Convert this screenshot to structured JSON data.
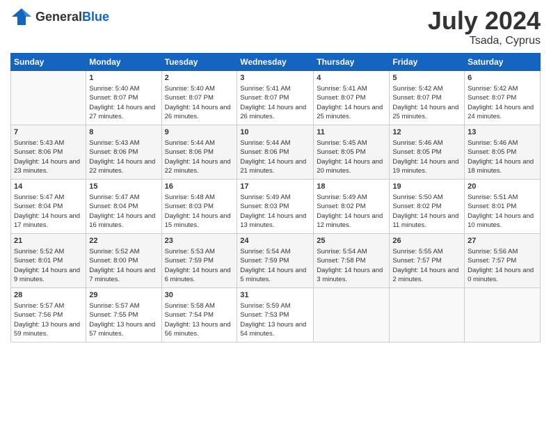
{
  "logo": {
    "general": "General",
    "blue": "Blue"
  },
  "title": "July 2024",
  "subtitle": "Tsada, Cyprus",
  "headers": [
    "Sunday",
    "Monday",
    "Tuesday",
    "Wednesday",
    "Thursday",
    "Friday",
    "Saturday"
  ],
  "weeks": [
    [
      {
        "day": "",
        "sunrise": "",
        "sunset": "",
        "daylight": ""
      },
      {
        "day": "1",
        "sunrise": "Sunrise: 5:40 AM",
        "sunset": "Sunset: 8:07 PM",
        "daylight": "Daylight: 14 hours and 27 minutes."
      },
      {
        "day": "2",
        "sunrise": "Sunrise: 5:40 AM",
        "sunset": "Sunset: 8:07 PM",
        "daylight": "Daylight: 14 hours and 26 minutes."
      },
      {
        "day": "3",
        "sunrise": "Sunrise: 5:41 AM",
        "sunset": "Sunset: 8:07 PM",
        "daylight": "Daylight: 14 hours and 26 minutes."
      },
      {
        "day": "4",
        "sunrise": "Sunrise: 5:41 AM",
        "sunset": "Sunset: 8:07 PM",
        "daylight": "Daylight: 14 hours and 25 minutes."
      },
      {
        "day": "5",
        "sunrise": "Sunrise: 5:42 AM",
        "sunset": "Sunset: 8:07 PM",
        "daylight": "Daylight: 14 hours and 25 minutes."
      },
      {
        "day": "6",
        "sunrise": "Sunrise: 5:42 AM",
        "sunset": "Sunset: 8:07 PM",
        "daylight": "Daylight: 14 hours and 24 minutes."
      }
    ],
    [
      {
        "day": "7",
        "sunrise": "Sunrise: 5:43 AM",
        "sunset": "Sunset: 8:06 PM",
        "daylight": "Daylight: 14 hours and 23 minutes."
      },
      {
        "day": "8",
        "sunrise": "Sunrise: 5:43 AM",
        "sunset": "Sunset: 8:06 PM",
        "daylight": "Daylight: 14 hours and 22 minutes."
      },
      {
        "day": "9",
        "sunrise": "Sunrise: 5:44 AM",
        "sunset": "Sunset: 8:06 PM",
        "daylight": "Daylight: 14 hours and 22 minutes."
      },
      {
        "day": "10",
        "sunrise": "Sunrise: 5:44 AM",
        "sunset": "Sunset: 8:06 PM",
        "daylight": "Daylight: 14 hours and 21 minutes."
      },
      {
        "day": "11",
        "sunrise": "Sunrise: 5:45 AM",
        "sunset": "Sunset: 8:05 PM",
        "daylight": "Daylight: 14 hours and 20 minutes."
      },
      {
        "day": "12",
        "sunrise": "Sunrise: 5:46 AM",
        "sunset": "Sunset: 8:05 PM",
        "daylight": "Daylight: 14 hours and 19 minutes."
      },
      {
        "day": "13",
        "sunrise": "Sunrise: 5:46 AM",
        "sunset": "Sunset: 8:05 PM",
        "daylight": "Daylight: 14 hours and 18 minutes."
      }
    ],
    [
      {
        "day": "14",
        "sunrise": "Sunrise: 5:47 AM",
        "sunset": "Sunset: 8:04 PM",
        "daylight": "Daylight: 14 hours and 17 minutes."
      },
      {
        "day": "15",
        "sunrise": "Sunrise: 5:47 AM",
        "sunset": "Sunset: 8:04 PM",
        "daylight": "Daylight: 14 hours and 16 minutes."
      },
      {
        "day": "16",
        "sunrise": "Sunrise: 5:48 AM",
        "sunset": "Sunset: 8:03 PM",
        "daylight": "Daylight: 14 hours and 15 minutes."
      },
      {
        "day": "17",
        "sunrise": "Sunrise: 5:49 AM",
        "sunset": "Sunset: 8:03 PM",
        "daylight": "Daylight: 14 hours and 13 minutes."
      },
      {
        "day": "18",
        "sunrise": "Sunrise: 5:49 AM",
        "sunset": "Sunset: 8:02 PM",
        "daylight": "Daylight: 14 hours and 12 minutes."
      },
      {
        "day": "19",
        "sunrise": "Sunrise: 5:50 AM",
        "sunset": "Sunset: 8:02 PM",
        "daylight": "Daylight: 14 hours and 11 minutes."
      },
      {
        "day": "20",
        "sunrise": "Sunrise: 5:51 AM",
        "sunset": "Sunset: 8:01 PM",
        "daylight": "Daylight: 14 hours and 10 minutes."
      }
    ],
    [
      {
        "day": "21",
        "sunrise": "Sunrise: 5:52 AM",
        "sunset": "Sunset: 8:01 PM",
        "daylight": "Daylight: 14 hours and 9 minutes."
      },
      {
        "day": "22",
        "sunrise": "Sunrise: 5:52 AM",
        "sunset": "Sunset: 8:00 PM",
        "daylight": "Daylight: 14 hours and 7 minutes."
      },
      {
        "day": "23",
        "sunrise": "Sunrise: 5:53 AM",
        "sunset": "Sunset: 7:59 PM",
        "daylight": "Daylight: 14 hours and 6 minutes."
      },
      {
        "day": "24",
        "sunrise": "Sunrise: 5:54 AM",
        "sunset": "Sunset: 7:59 PM",
        "daylight": "Daylight: 14 hours and 5 minutes."
      },
      {
        "day": "25",
        "sunrise": "Sunrise: 5:54 AM",
        "sunset": "Sunset: 7:58 PM",
        "daylight": "Daylight: 14 hours and 3 minutes."
      },
      {
        "day": "26",
        "sunrise": "Sunrise: 5:55 AM",
        "sunset": "Sunset: 7:57 PM",
        "daylight": "Daylight: 14 hours and 2 minutes."
      },
      {
        "day": "27",
        "sunrise": "Sunrise: 5:56 AM",
        "sunset": "Sunset: 7:57 PM",
        "daylight": "Daylight: 14 hours and 0 minutes."
      }
    ],
    [
      {
        "day": "28",
        "sunrise": "Sunrise: 5:57 AM",
        "sunset": "Sunset: 7:56 PM",
        "daylight": "Daylight: 13 hours and 59 minutes."
      },
      {
        "day": "29",
        "sunrise": "Sunrise: 5:57 AM",
        "sunset": "Sunset: 7:55 PM",
        "daylight": "Daylight: 13 hours and 57 minutes."
      },
      {
        "day": "30",
        "sunrise": "Sunrise: 5:58 AM",
        "sunset": "Sunset: 7:54 PM",
        "daylight": "Daylight: 13 hours and 56 minutes."
      },
      {
        "day": "31",
        "sunrise": "Sunrise: 5:59 AM",
        "sunset": "Sunset: 7:53 PM",
        "daylight": "Daylight: 13 hours and 54 minutes."
      },
      {
        "day": "",
        "sunrise": "",
        "sunset": "",
        "daylight": ""
      },
      {
        "day": "",
        "sunrise": "",
        "sunset": "",
        "daylight": ""
      },
      {
        "day": "",
        "sunrise": "",
        "sunset": "",
        "daylight": ""
      }
    ]
  ]
}
